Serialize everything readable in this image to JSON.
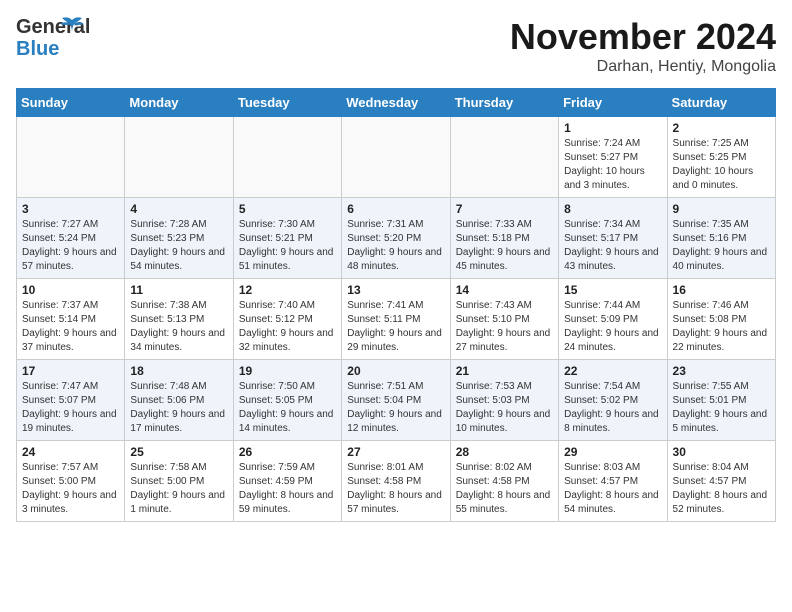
{
  "header": {
    "logo_general": "General",
    "logo_blue": "Blue",
    "month_year": "November 2024",
    "location": "Darhan, Hentiy, Mongolia"
  },
  "days_of_week": [
    "Sunday",
    "Monday",
    "Tuesday",
    "Wednesday",
    "Thursday",
    "Friday",
    "Saturday"
  ],
  "weeks": [
    [
      {
        "day": "",
        "detail": ""
      },
      {
        "day": "",
        "detail": ""
      },
      {
        "day": "",
        "detail": ""
      },
      {
        "day": "",
        "detail": ""
      },
      {
        "day": "",
        "detail": ""
      },
      {
        "day": "1",
        "detail": "Sunrise: 7:24 AM\nSunset: 5:27 PM\nDaylight: 10 hours and 3 minutes."
      },
      {
        "day": "2",
        "detail": "Sunrise: 7:25 AM\nSunset: 5:25 PM\nDaylight: 10 hours and 0 minutes."
      }
    ],
    [
      {
        "day": "3",
        "detail": "Sunrise: 7:27 AM\nSunset: 5:24 PM\nDaylight: 9 hours and 57 minutes."
      },
      {
        "day": "4",
        "detail": "Sunrise: 7:28 AM\nSunset: 5:23 PM\nDaylight: 9 hours and 54 minutes."
      },
      {
        "day": "5",
        "detail": "Sunrise: 7:30 AM\nSunset: 5:21 PM\nDaylight: 9 hours and 51 minutes."
      },
      {
        "day": "6",
        "detail": "Sunrise: 7:31 AM\nSunset: 5:20 PM\nDaylight: 9 hours and 48 minutes."
      },
      {
        "day": "7",
        "detail": "Sunrise: 7:33 AM\nSunset: 5:18 PM\nDaylight: 9 hours and 45 minutes."
      },
      {
        "day": "8",
        "detail": "Sunrise: 7:34 AM\nSunset: 5:17 PM\nDaylight: 9 hours and 43 minutes."
      },
      {
        "day": "9",
        "detail": "Sunrise: 7:35 AM\nSunset: 5:16 PM\nDaylight: 9 hours and 40 minutes."
      }
    ],
    [
      {
        "day": "10",
        "detail": "Sunrise: 7:37 AM\nSunset: 5:14 PM\nDaylight: 9 hours and 37 minutes."
      },
      {
        "day": "11",
        "detail": "Sunrise: 7:38 AM\nSunset: 5:13 PM\nDaylight: 9 hours and 34 minutes."
      },
      {
        "day": "12",
        "detail": "Sunrise: 7:40 AM\nSunset: 5:12 PM\nDaylight: 9 hours and 32 minutes."
      },
      {
        "day": "13",
        "detail": "Sunrise: 7:41 AM\nSunset: 5:11 PM\nDaylight: 9 hours and 29 minutes."
      },
      {
        "day": "14",
        "detail": "Sunrise: 7:43 AM\nSunset: 5:10 PM\nDaylight: 9 hours and 27 minutes."
      },
      {
        "day": "15",
        "detail": "Sunrise: 7:44 AM\nSunset: 5:09 PM\nDaylight: 9 hours and 24 minutes."
      },
      {
        "day": "16",
        "detail": "Sunrise: 7:46 AM\nSunset: 5:08 PM\nDaylight: 9 hours and 22 minutes."
      }
    ],
    [
      {
        "day": "17",
        "detail": "Sunrise: 7:47 AM\nSunset: 5:07 PM\nDaylight: 9 hours and 19 minutes."
      },
      {
        "day": "18",
        "detail": "Sunrise: 7:48 AM\nSunset: 5:06 PM\nDaylight: 9 hours and 17 minutes."
      },
      {
        "day": "19",
        "detail": "Sunrise: 7:50 AM\nSunset: 5:05 PM\nDaylight: 9 hours and 14 minutes."
      },
      {
        "day": "20",
        "detail": "Sunrise: 7:51 AM\nSunset: 5:04 PM\nDaylight: 9 hours and 12 minutes."
      },
      {
        "day": "21",
        "detail": "Sunrise: 7:53 AM\nSunset: 5:03 PM\nDaylight: 9 hours and 10 minutes."
      },
      {
        "day": "22",
        "detail": "Sunrise: 7:54 AM\nSunset: 5:02 PM\nDaylight: 9 hours and 8 minutes."
      },
      {
        "day": "23",
        "detail": "Sunrise: 7:55 AM\nSunset: 5:01 PM\nDaylight: 9 hours and 5 minutes."
      }
    ],
    [
      {
        "day": "24",
        "detail": "Sunrise: 7:57 AM\nSunset: 5:00 PM\nDaylight: 9 hours and 3 minutes."
      },
      {
        "day": "25",
        "detail": "Sunrise: 7:58 AM\nSunset: 5:00 PM\nDaylight: 9 hours and 1 minute."
      },
      {
        "day": "26",
        "detail": "Sunrise: 7:59 AM\nSunset: 4:59 PM\nDaylight: 8 hours and 59 minutes."
      },
      {
        "day": "27",
        "detail": "Sunrise: 8:01 AM\nSunset: 4:58 PM\nDaylight: 8 hours and 57 minutes."
      },
      {
        "day": "28",
        "detail": "Sunrise: 8:02 AM\nSunset: 4:58 PM\nDaylight: 8 hours and 55 minutes."
      },
      {
        "day": "29",
        "detail": "Sunrise: 8:03 AM\nSunset: 4:57 PM\nDaylight: 8 hours and 54 minutes."
      },
      {
        "day": "30",
        "detail": "Sunrise: 8:04 AM\nSunset: 4:57 PM\nDaylight: 8 hours and 52 minutes."
      }
    ]
  ]
}
